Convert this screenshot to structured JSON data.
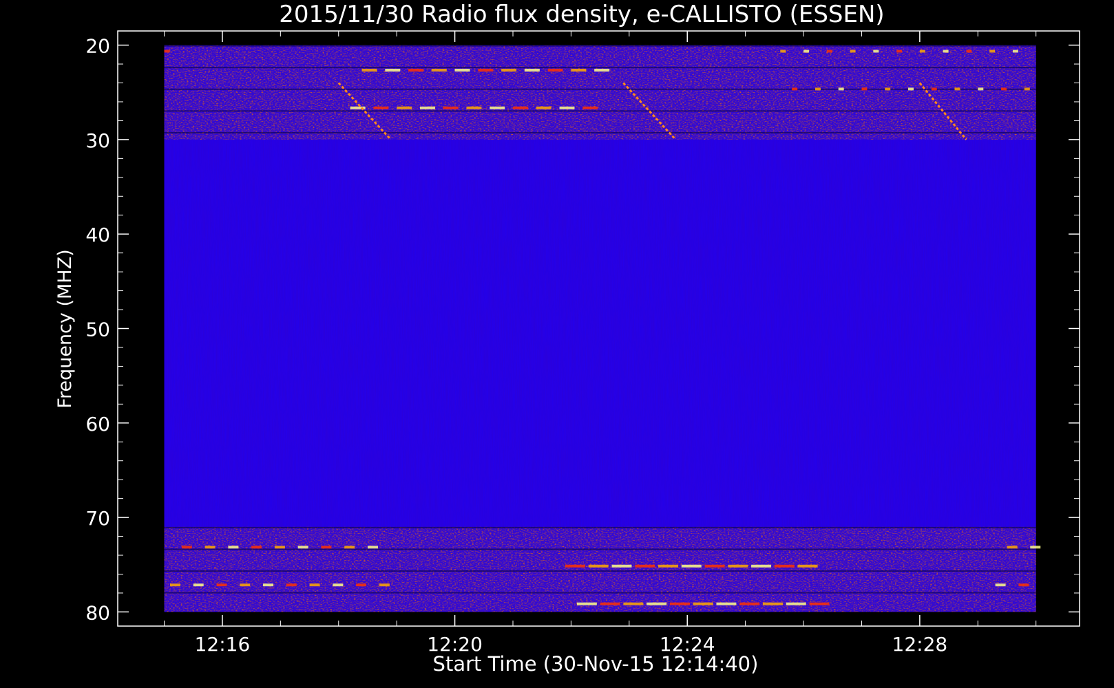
{
  "chart_data": {
    "type": "heatmap",
    "title": "2015/11/30  Radio flux density, e-CALLISTO (ESSEN)",
    "xlabel": "Start Time (30-Nov-15 12:14:40)",
    "ylabel": "Frequency (MHZ)",
    "x_ticks": [
      "12:16",
      "12:20",
      "12:24",
      "12:28"
    ],
    "x_tick_minutes": [
      16,
      20,
      24,
      28
    ],
    "xlim_minutes": [
      14.2,
      30.75
    ],
    "data_x_range_minutes": [
      15.0,
      30.0
    ],
    "y_ticks": [
      "20",
      "30",
      "40",
      "50",
      "60",
      "70",
      "80"
    ],
    "y_tick_values": [
      20,
      30,
      40,
      50,
      60,
      70,
      80
    ],
    "ylim": [
      18.5,
      81.5
    ],
    "data_y_range": [
      20,
      80
    ],
    "y_inverted": true,
    "grid": false,
    "background_color": "#2200ee",
    "colormap": [
      "#000000",
      "#2200ee",
      "#aa0000",
      "#ff3300",
      "#ffaa00",
      "#ffff88"
    ],
    "emission_bands_mhz": [
      {
        "range": [
          20,
          30
        ],
        "level": "intermittent interference"
      },
      {
        "range": [
          71,
          80
        ],
        "level": "intermittent interference"
      }
    ],
    "drifting_bursts": [
      {
        "start_minute": 18.0,
        "end_minute": 18.9,
        "freq_from": 24,
        "freq_to": 30
      },
      {
        "start_minute": 22.9,
        "end_minute": 23.8,
        "freq_from": 24,
        "freq_to": 30
      },
      {
        "start_minute": 28.0,
        "end_minute": 28.8,
        "freq_from": 24,
        "freq_to": 30
      }
    ]
  }
}
